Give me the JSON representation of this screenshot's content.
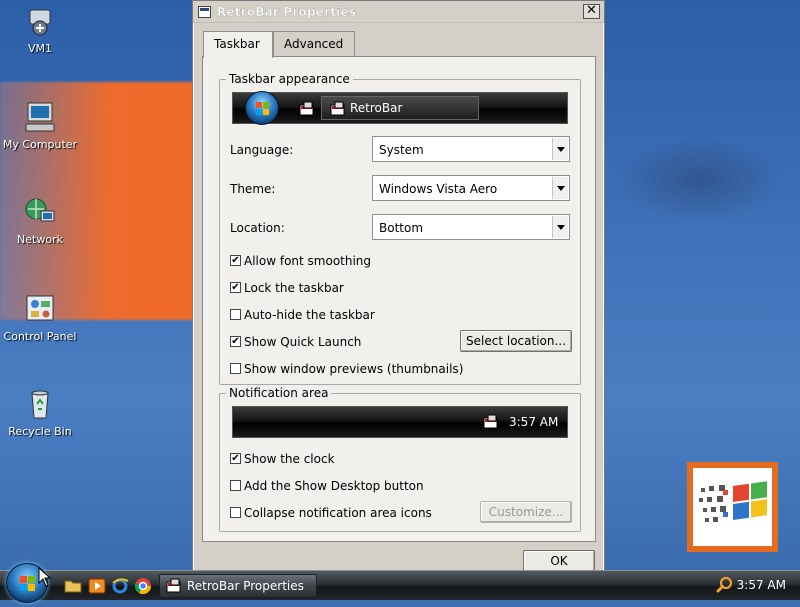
{
  "desktop": {
    "icons": [
      {
        "label": "VM1"
      },
      {
        "label": "My Computer"
      },
      {
        "label": "Network"
      },
      {
        "label": "Control Panel"
      },
      {
        "label": "Recycle Bin"
      }
    ]
  },
  "window": {
    "title": "RetroBar Properties",
    "close_glyph": "✕",
    "tabs": [
      {
        "label": "Taskbar",
        "active": true
      },
      {
        "label": "Advanced",
        "active": false
      }
    ],
    "taskbar_appearance": {
      "title": "Taskbar appearance",
      "preview_button_label": "RetroBar",
      "fields": [
        {
          "label": "Language:",
          "value": "System"
        },
        {
          "label": "Theme:",
          "value": "Windows Vista Aero"
        },
        {
          "label": "Location:",
          "value": "Bottom"
        }
      ],
      "checkboxes": [
        {
          "label": "Allow font smoothing",
          "checked": true
        },
        {
          "label": "Lock the taskbar",
          "checked": true
        },
        {
          "label": "Auto-hide the taskbar",
          "checked": false
        },
        {
          "label": "Show Quick Launch",
          "checked": true
        },
        {
          "label": "Show window previews (thumbnails)",
          "checked": false
        }
      ],
      "select_location_label": "Select location..."
    },
    "notification_area": {
      "title": "Notification area",
      "preview_clock": "3:57 AM",
      "checkboxes": [
        {
          "label": "Show the clock",
          "checked": true
        },
        {
          "label": "Add the Show Desktop button",
          "checked": false
        },
        {
          "label": "Collapse notification area icons",
          "checked": false
        }
      ],
      "customize_label": "Customize..."
    },
    "ok_label": "OK",
    "check_glyph": "✔"
  },
  "taskbar": {
    "task_button_label": "RetroBar Properties",
    "clock": "3:57 AM",
    "quick_launch": [
      "folder-icon",
      "media-player-icon",
      "internet-explorer-icon",
      "chrome-icon"
    ]
  },
  "colors": {
    "desktop_blue": "#3a6cb4",
    "desktop_orange": "#f06a25",
    "window_face": "#d4d0c8",
    "tab_panel": "#f1f0ec"
  }
}
